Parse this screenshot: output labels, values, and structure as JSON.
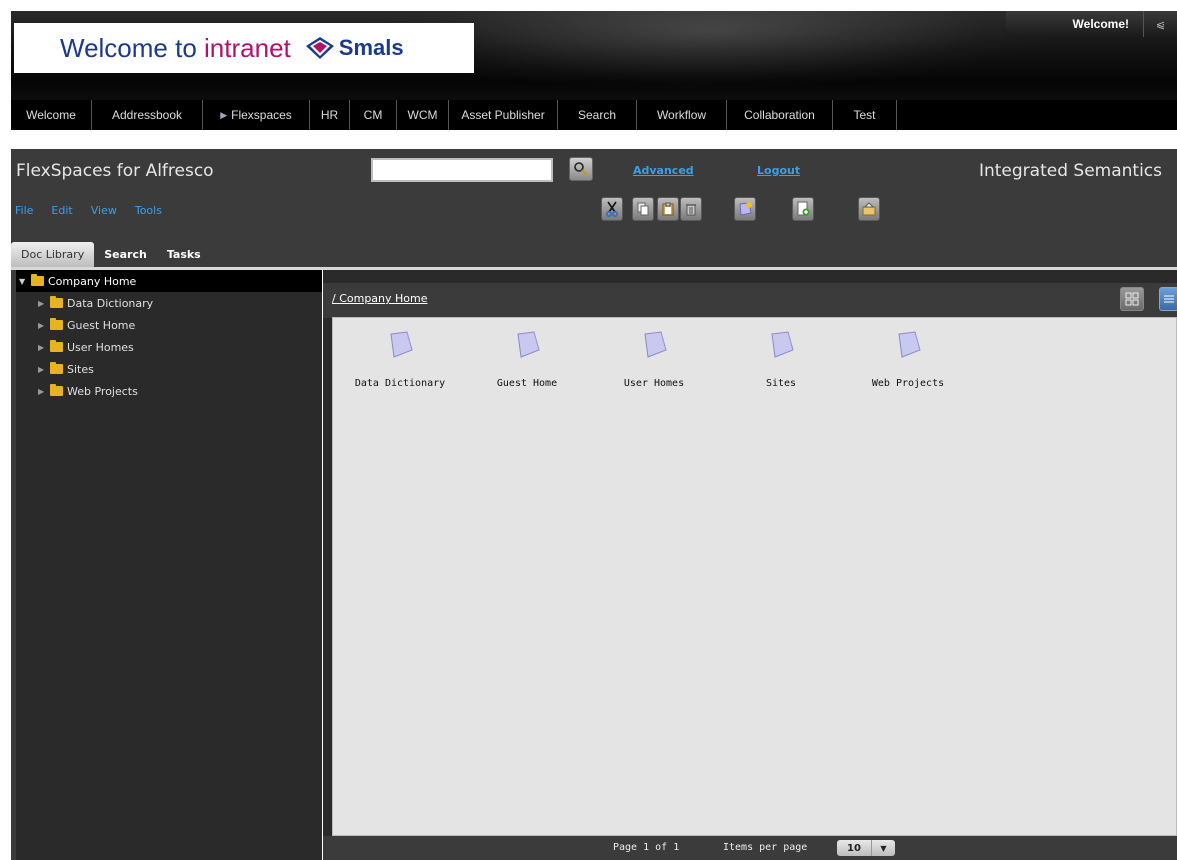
{
  "portal": {
    "logo_text_prefix": "Welcome to",
    "logo_text_accent": "intranet",
    "logo_brand": "Smals",
    "welcome_label": "Welcome!",
    "welcome_toggle": "⩿",
    "nav": [
      {
        "label": "Welcome"
      },
      {
        "label": "Addressbook"
      },
      {
        "label": "Flexspaces",
        "active": true
      },
      {
        "label": "HR"
      },
      {
        "label": "CM"
      },
      {
        "label": "WCM"
      },
      {
        "label": "Asset Publisher"
      },
      {
        "label": "Search"
      },
      {
        "label": "Workflow"
      },
      {
        "label": "Collaboration"
      },
      {
        "label": "Test"
      }
    ],
    "nav_active_marker": "▶"
  },
  "app": {
    "title": "FlexSpaces for Alfresco",
    "brand": "Integrated Semantics",
    "search": {
      "value": "",
      "placeholder": ""
    },
    "links": {
      "advanced": "Advanced",
      "logout": "Logout"
    },
    "menu": [
      "File",
      "Edit",
      "View",
      "Tools"
    ],
    "toolbar_icons": [
      "cut-icon",
      "copy-icon",
      "paste-icon",
      "delete-icon",
      "new-space-icon",
      "new-document-icon",
      "upload-icon"
    ],
    "tabs": [
      {
        "label": "Doc Library",
        "active": true
      },
      {
        "label": "Search"
      },
      {
        "label": "Tasks"
      }
    ]
  },
  "tree": {
    "root": "Company Home",
    "root_toggle": "▼",
    "node_toggle": "▶",
    "children": [
      "Data Dictionary",
      "Guest Home",
      "User Homes",
      "Sites",
      "Web Projects"
    ]
  },
  "content": {
    "breadcrumb": "/ Company Home",
    "items": [
      "Data Dictionary",
      "Guest Home",
      "User Homes",
      "Sites",
      "Web Projects"
    ],
    "pager": {
      "page_info": "Page 1 of 1",
      "per_page_label": "Items per page",
      "per_page_value": "10",
      "per_page_arrow": "▼"
    }
  },
  "colors": {
    "link_blue": "#3aa0e8",
    "logo_blue": "#1c3a8c",
    "logo_magenta": "#b3126b",
    "folder_yellow": "#e8b320",
    "panel_dark": "#2a2a2a",
    "chrome_gray": "#3b3b3b"
  }
}
